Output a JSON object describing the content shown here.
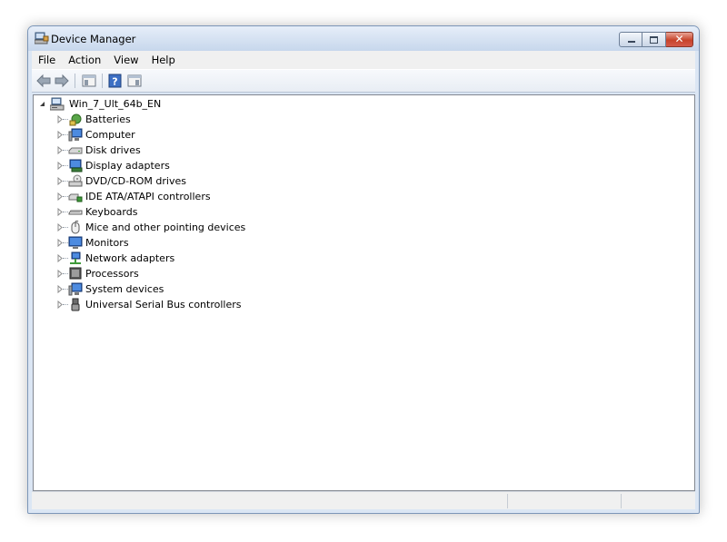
{
  "window": {
    "title": "Device Manager",
    "caption_buttons": [
      "minimize",
      "maximize",
      "close"
    ]
  },
  "menubar": {
    "items": [
      "File",
      "Action",
      "View",
      "Help"
    ]
  },
  "toolbar": {
    "buttons": [
      {
        "name": "back",
        "icon": "back-arrow-icon"
      },
      {
        "name": "forward",
        "icon": "forward-arrow-icon"
      },
      {
        "name": "show-hide-console-tree",
        "icon": "console-tree-icon"
      },
      {
        "name": "help",
        "icon": "help-icon"
      },
      {
        "name": "show-hide-action-pane",
        "icon": "action-pane-icon"
      }
    ]
  },
  "tree": {
    "root": {
      "label": "Win_7_Ult_64b_EN",
      "icon": "computer-root-icon",
      "expanded": true
    },
    "items": [
      {
        "label": "Batteries",
        "icon": "battery-icon"
      },
      {
        "label": "Computer",
        "icon": "computer-icon"
      },
      {
        "label": "Disk drives",
        "icon": "disk-drive-icon"
      },
      {
        "label": "Display adapters",
        "icon": "display-adapter-icon"
      },
      {
        "label": "DVD/CD-ROM drives",
        "icon": "dvd-drive-icon"
      },
      {
        "label": "IDE ATA/ATAPI controllers",
        "icon": "ide-controller-icon"
      },
      {
        "label": "Keyboards",
        "icon": "keyboard-icon"
      },
      {
        "label": "Mice and other pointing devices",
        "icon": "mouse-icon"
      },
      {
        "label": "Monitors",
        "icon": "monitor-icon"
      },
      {
        "label": "Network adapters",
        "icon": "network-adapter-icon"
      },
      {
        "label": "Processors",
        "icon": "processor-icon"
      },
      {
        "label": "System devices",
        "icon": "system-devices-icon"
      },
      {
        "label": "Universal Serial Bus controllers",
        "icon": "usb-controller-icon"
      }
    ]
  },
  "statusbar": {
    "panes": [
      "",
      "",
      ""
    ]
  },
  "colors": {
    "titlebar_top": "#e6eef9",
    "titlebar_bottom": "#c7d7ec",
    "close_button": "#c7432b",
    "tree_background": "#ffffff"
  }
}
